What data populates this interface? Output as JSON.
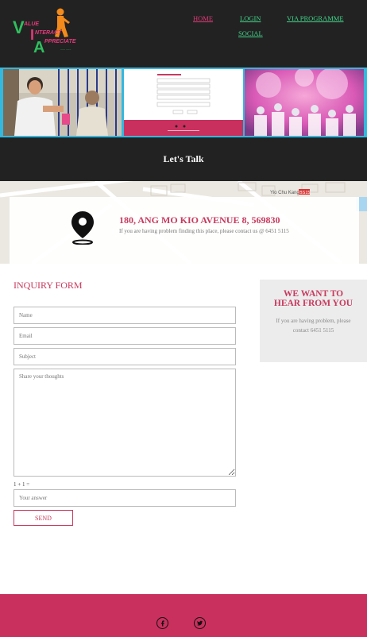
{
  "logo": {
    "text": "VALUE INTERACT APPRECIATE",
    "letters": [
      "V",
      "I",
      "A"
    ],
    "words": [
      "ALUE",
      "NTERACT",
      "PPRECIATE"
    ]
  },
  "nav": {
    "home": "HOME",
    "login": "LOGIN",
    "via_programme": "VIA PROGRAMME",
    "social": "SOCIAL"
  },
  "banner": {
    "panels": [
      "photo-volunteer-visit",
      "form-screenshot",
      "color-run-photo"
    ]
  },
  "talk": {
    "heading": "Let's Talk"
  },
  "map": {
    "address": "180, ANG MO KIO AVENUE 8, 569830",
    "note": "If you are having problem finding this place, please contact us @ 6451 5115",
    "road_label": "Yio Chu Kang",
    "road_badge": "BS15"
  },
  "form": {
    "title": "INQUIRY FORM",
    "name_placeholder": "Name",
    "email_placeholder": "Email",
    "subject_placeholder": "Subject",
    "thoughts_placeholder": "Share your thoughts",
    "captcha": "1 + 1 =",
    "answer_placeholder": "Your answer",
    "send": "SEND"
  },
  "side": {
    "heading": "WE WANT TO HEAR FROM YOU",
    "text": "If you are having problem, please contact 6451 5115"
  },
  "footer": {
    "icons": [
      "facebook-icon",
      "twitter-icon"
    ]
  },
  "colors": {
    "accent": "#c83a5e",
    "dark": "#222222",
    "green": "#43d48a",
    "footer": "#c9305e",
    "banner_border": "#33b8df"
  }
}
